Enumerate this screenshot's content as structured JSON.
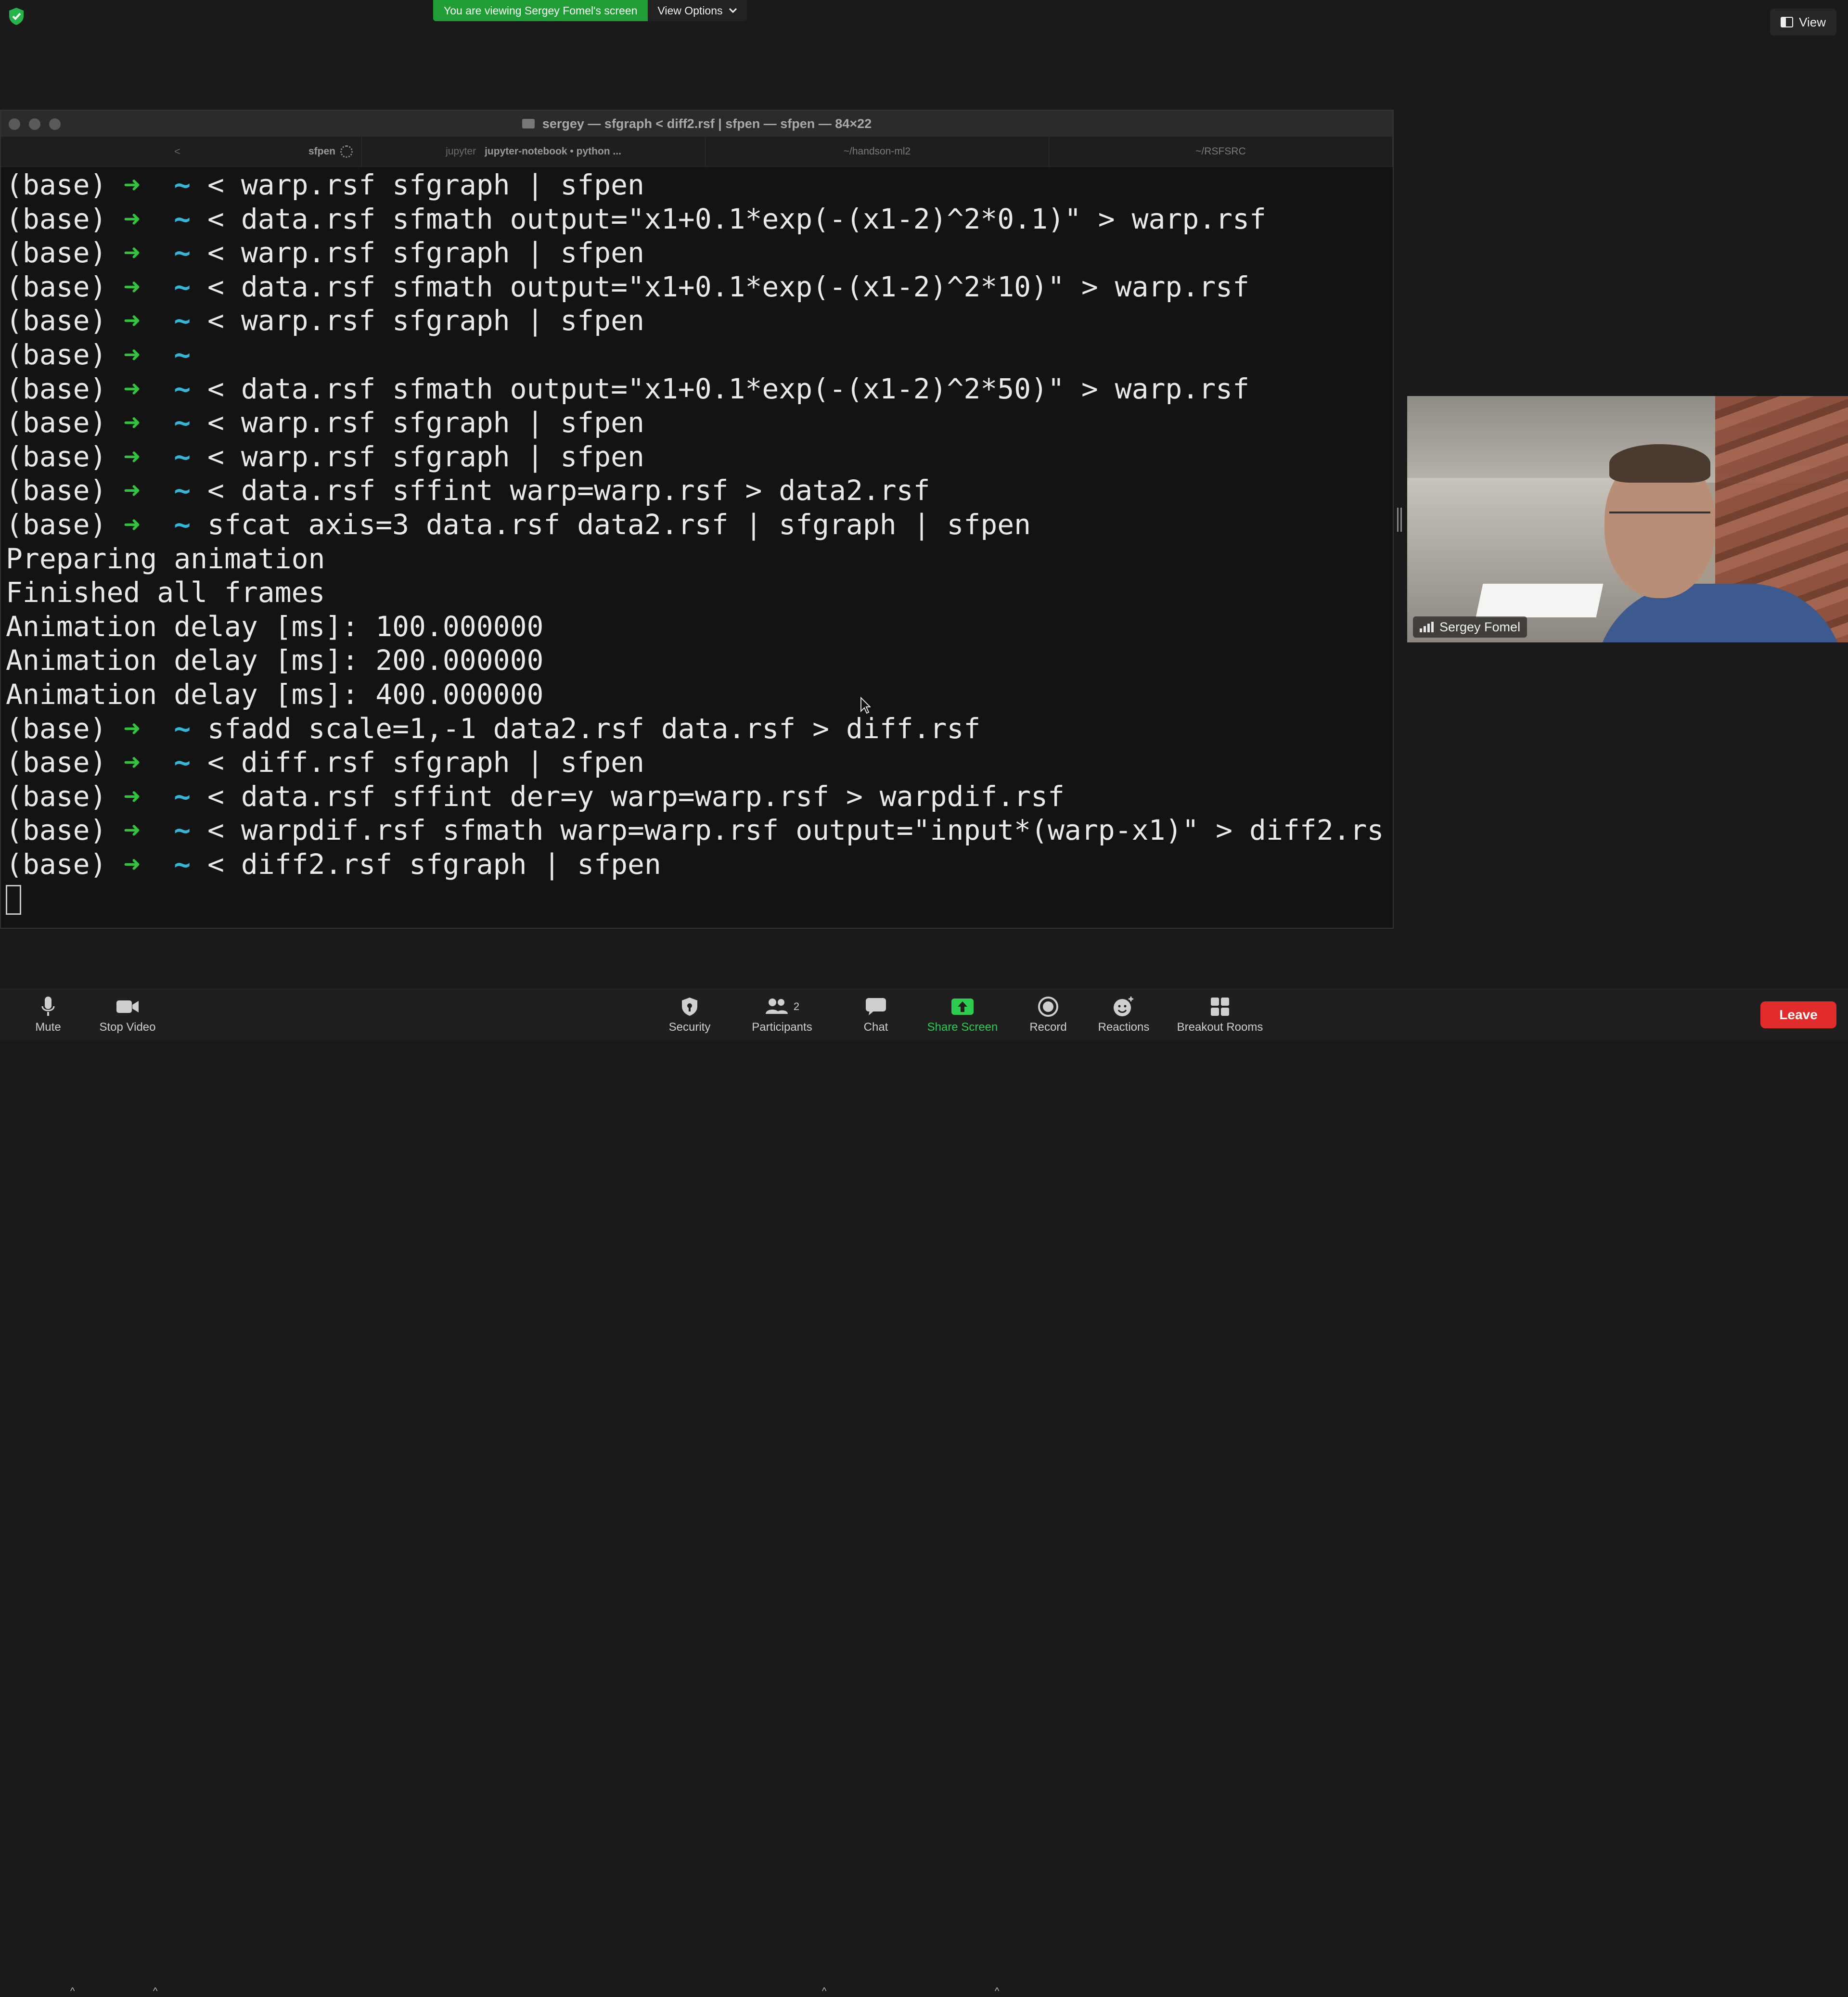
{
  "banner": {
    "viewing_text": "You are viewing Sergey Fomel's screen",
    "view_options_label": "View Options"
  },
  "top_right": {
    "view_label": "View"
  },
  "terminal": {
    "title": "sergey — sfgraph < diff2.rsf | sfpen — sfpen — 84×22",
    "tabs": [
      {
        "label": "sfpen",
        "sub": ""
      },
      {
        "label": "jupyter-notebook • python ...",
        "sub": "jupyter"
      },
      {
        "label": "~/handson-ml2",
        "sub": ""
      },
      {
        "label": "~/RSFSRC",
        "sub": ""
      }
    ],
    "prompt": {
      "base": "(base)",
      "arrow": "➜",
      "tilde": "~"
    },
    "lines": [
      {
        "type": "cmd",
        "text": " < warp.rsf sfgraph | sfpen"
      },
      {
        "type": "cmd",
        "text": " < data.rsf sfmath output=\"x1+0.1*exp(-(x1-2)^2*0.1)\" > warp.rsf"
      },
      {
        "type": "cmd",
        "text": " < warp.rsf sfgraph | sfpen"
      },
      {
        "type": "cmd",
        "text": " < data.rsf sfmath output=\"x1+0.1*exp(-(x1-2)^2*10)\" > warp.rsf"
      },
      {
        "type": "cmd",
        "text": " < warp.rsf sfgraph | sfpen"
      },
      {
        "type": "cmd",
        "text": ""
      },
      {
        "type": "cmd",
        "text": " < data.rsf sfmath output=\"x1+0.1*exp(-(x1-2)^2*50)\" > warp.rsf"
      },
      {
        "type": "cmd",
        "text": " < warp.rsf sfgraph | sfpen"
      },
      {
        "type": "cmd",
        "text": " < warp.rsf sfgraph | sfpen"
      },
      {
        "type": "cmd",
        "text": " < data.rsf sffint warp=warp.rsf > data2.rsf"
      },
      {
        "type": "cmd",
        "text": " sfcat axis=3 data.rsf data2.rsf | sfgraph | sfpen"
      },
      {
        "type": "out",
        "text": "Preparing animation"
      },
      {
        "type": "out",
        "text": "Finished all frames"
      },
      {
        "type": "out",
        "text": "Animation delay [ms]: 100.000000"
      },
      {
        "type": "out",
        "text": "Animation delay [ms]: 200.000000"
      },
      {
        "type": "out",
        "text": "Animation delay [ms]: 400.000000"
      },
      {
        "type": "cmd",
        "text": " sfadd scale=1,-1 data2.rsf data.rsf > diff.rsf"
      },
      {
        "type": "cmd",
        "text": " < diff.rsf sfgraph | sfpen"
      },
      {
        "type": "cmd",
        "text": " < data.rsf sffint der=y warp=warp.rsf > warpdif.rsf"
      },
      {
        "type": "cmd",
        "text": " < warpdif.rsf sfmath warp=warp.rsf output=\"input*(warp-x1)\" > diff2.rs"
      },
      {
        "type": "cmd",
        "text": " < diff2.rsf sfgraph | sfpen"
      }
    ]
  },
  "video": {
    "participant_name": "Sergey Fomel"
  },
  "toolbar": {
    "mute": "Mute",
    "stop_video": "Stop Video",
    "security": "Security",
    "participants": "Participants",
    "participants_count": "2",
    "chat": "Chat",
    "share_screen": "Share Screen",
    "record": "Record",
    "reactions": "Reactions",
    "breakout_rooms": "Breakout Rooms",
    "leave": "Leave"
  },
  "colors": {
    "banner_green": "#1f9e36",
    "prompt_arrow": "#32c33f",
    "prompt_tilde": "#36b6d6",
    "share_green": "#2ecc51",
    "leave_red": "#e22b2b"
  }
}
